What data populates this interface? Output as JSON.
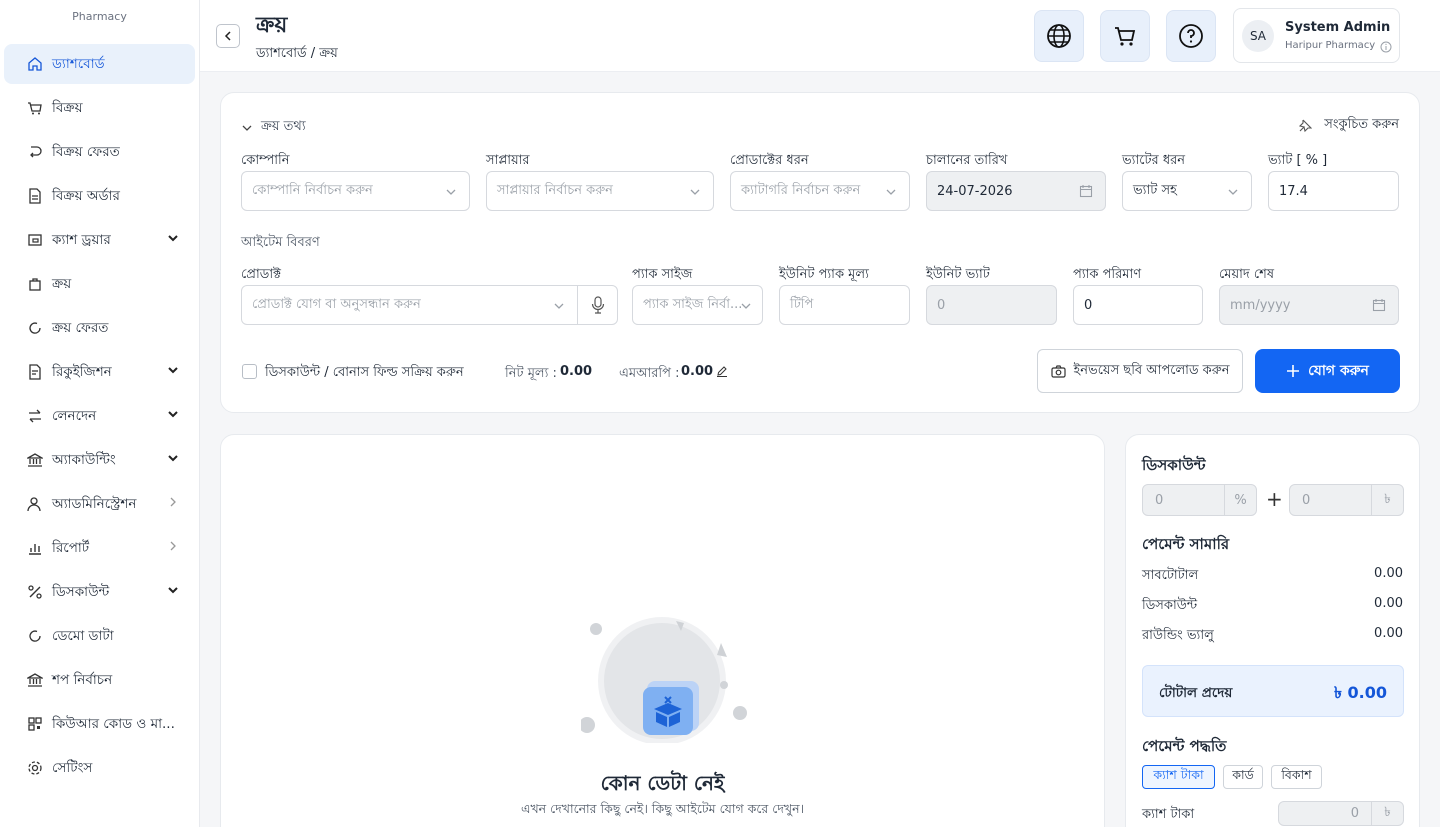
{
  "brand": {
    "sub": "Pharmacy"
  },
  "sidebar": {
    "items": [
      {
        "label": "ড্যাশবোর্ড",
        "icon": "home-icon"
      },
      {
        "label": "বিক্রয়",
        "icon": "cart-icon"
      },
      {
        "label": "বিক্রয় ফেরত",
        "icon": "return-icon"
      },
      {
        "label": "বিক্রয় অর্ডার",
        "icon": "document-icon"
      },
      {
        "label": "ক্যাশ ড্রয়ার",
        "icon": "cash-drawer-icon"
      },
      {
        "label": "ক্রয়",
        "icon": "bag-icon"
      },
      {
        "label": "ক্রয় ফেরত",
        "icon": "refresh-icon"
      },
      {
        "label": "রিকুইজিশন",
        "icon": "requisition-icon"
      },
      {
        "label": "লেনদেন",
        "icon": "transfer-icon"
      },
      {
        "label": "অ্যাকাউন্টিং",
        "icon": "bank-icon"
      },
      {
        "label": "অ্যাডমিনিস্ট্রেশন",
        "icon": "admin-icon"
      },
      {
        "label": "রিপোর্ট",
        "icon": "report-icon"
      },
      {
        "label": "ডিসকাউন্ট",
        "icon": "percent-icon"
      },
      {
        "label": "ডেমো ডাটা",
        "icon": "demo-icon"
      },
      {
        "label": "শপ নির্বাচন",
        "icon": "shop-icon"
      },
      {
        "label": "কিউআর কোড ও মা...",
        "icon": "qr-code-icon"
      },
      {
        "label": "সেটিংস",
        "icon": "gear-icon"
      }
    ]
  },
  "header": {
    "title": "ক্রয়",
    "breadcrumb": "ড্যাশবোর্ড / ক্রয়"
  },
  "user": {
    "initials": "SA",
    "name": "System Admin",
    "org": "Haripur Pharmacy"
  },
  "purchase_info": {
    "section_title": "ক্রয় তথ্য",
    "collapse_label": "সংকুচিত করুন",
    "company": {
      "label": "কোম্পানি",
      "placeholder": "কোম্পানি নির্বাচন করুন"
    },
    "supplier": {
      "label": "সাপ্লায়ার",
      "placeholder": "সাপ্লায়ার নির্বাচন করুন"
    },
    "product_type": {
      "label": "প্রোডাক্টের ধরন",
      "placeholder": "ক্যাটাগরি নির্বাচন করুন"
    },
    "invoice_date": {
      "label": "চালানের তারিখ",
      "value": "24-07-2026"
    },
    "vat_type": {
      "label": "ভ্যাটের ধরন",
      "value": "ভ্যাট সহ"
    },
    "vat_percent": {
      "label": "ভ্যাট [ % ]",
      "value": "17.4"
    },
    "item_section": "আইটেম বিবরণ",
    "product": {
      "label": "প্রোডাক্ট",
      "placeholder": "প্রোডাক্ট যোগ বা অনুসন্ধান করুন"
    },
    "pack_size": {
      "label": "প্যাক সাইজ",
      "placeholder": "প্যাক সাইজ নির্বা..."
    },
    "unit_pack_price": {
      "label": "ইউনিট প্যাক মূল্য",
      "placeholder": "টিপি"
    },
    "unit_vat": {
      "label": "ইউনিট ভ্যাট",
      "value": "0"
    },
    "pack_qty": {
      "label": "প্যাক পরিমাণ",
      "value": "0"
    },
    "expiry": {
      "label": "মেয়াদ শেষ",
      "placeholder": "mm/yyyy"
    },
    "discount_toggle": "ডিসকাউন্ট / বোনাস ফিল্ড সক্রিয় করুন",
    "net_price_label": "নিট মূল্য :",
    "net_price_value": "0.00",
    "mrp_label": "এমআরপি :",
    "mrp_value": "0.00",
    "upload_label": "ইনভয়েস ছবি আপলোড করুন",
    "add_label": "যোগ করুন"
  },
  "empty": {
    "title": "কোন ডেটা নেই",
    "subtitle": "এখন দেখানোর কিছু নেই। কিছু আইটেম যোগ করে দেখুন।"
  },
  "summary": {
    "discount_title": "ডিসকাউন্ট",
    "discount_percent": "0",
    "percent_symbol": "%",
    "plus": "+",
    "discount_amount": "0",
    "currency": "৳",
    "payment_summary_title": "পেমেন্ট সামারি",
    "rows": [
      {
        "label": "সাবটোটাল",
        "value": "0.00"
      },
      {
        "label": "ডিসকাউন্ট",
        "value": "0.00"
      },
      {
        "label": "রাউন্ডিং ভ্যালু",
        "value": "0.00"
      }
    ],
    "total_label": "টোটাল প্রদেয়",
    "total_value": "৳ 0.00",
    "payment_method_title": "পেমেন্ট পদ্ধতি",
    "methods": [
      "ক্যাশ টাকা",
      "কার্ড",
      "বিকাশ"
    ],
    "cash_label": "ক্যাশ টাকা",
    "cash_value": "0"
  },
  "colors": {
    "primary": "#1366f3",
    "active_bg": "#e9f1fb",
    "accent_text": "#1456d8"
  }
}
